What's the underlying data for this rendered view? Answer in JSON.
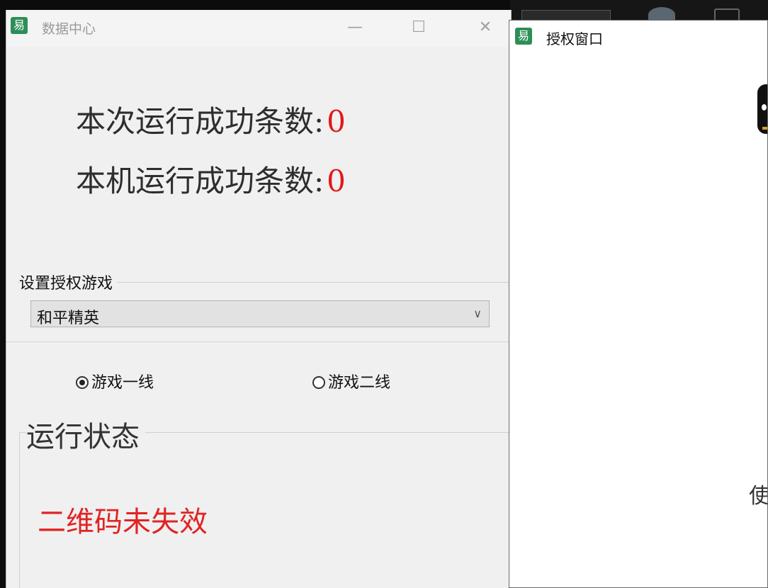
{
  "main_window": {
    "title": "数据中心",
    "icon_glyph": "易",
    "controls": {
      "minimize": "—",
      "maximize": "☐",
      "close": "✕"
    },
    "counts": [
      {
        "label": "本次运行成功条数:",
        "value": "0"
      },
      {
        "label": "本机运行成功条数:",
        "value": "0"
      }
    ],
    "game_group": {
      "label": "设置授权游戏",
      "selected": "和平精英",
      "dropdown_icon": "chevron-down-icon"
    },
    "radios": [
      {
        "label": "游戏一线",
        "checked": true
      },
      {
        "label": "游戏二线",
        "checked": false
      }
    ],
    "status_group": {
      "label": "运行状态",
      "message": "二维码未失效"
    }
  },
  "auth_window": {
    "title": "授权窗口",
    "icon_glyph": "易",
    "partial_text": "使"
  },
  "colors": {
    "accent_red": "#e01919",
    "app_icon_green": "#2d8f57"
  }
}
